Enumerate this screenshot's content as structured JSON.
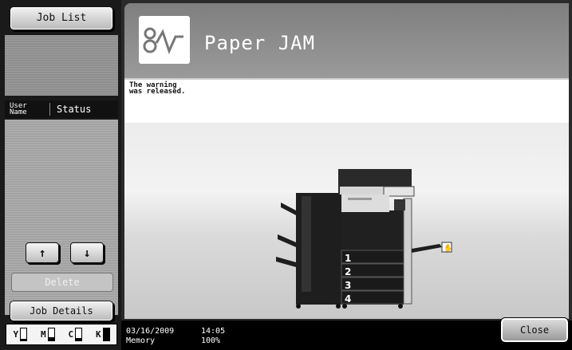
{
  "left": {
    "job_list_label": "Job List",
    "col_user": "User\nName",
    "col_status": "Status",
    "up_arrow": "↑",
    "down_arrow": "↓",
    "delete_label": "Delete",
    "job_details_label": "Job Details"
  },
  "toner": [
    {
      "label": "Y",
      "level": 0.15
    },
    {
      "label": "M",
      "level": 0.25
    },
    {
      "label": "C",
      "level": 0.2
    },
    {
      "label": "K",
      "level": 1.0
    }
  ],
  "main": {
    "title": "Paper JAM",
    "message": "The warning\nwas released.",
    "tray_numbers": [
      "1",
      "2",
      "3",
      "4"
    ]
  },
  "status_bar": {
    "date": "03/16/2009",
    "time": "14:05",
    "memory_label": "Memory",
    "memory_value": "100%"
  },
  "close_label": "Close",
  "colors": {
    "toner_fill": "#000000",
    "title_text": "#ffffff"
  }
}
